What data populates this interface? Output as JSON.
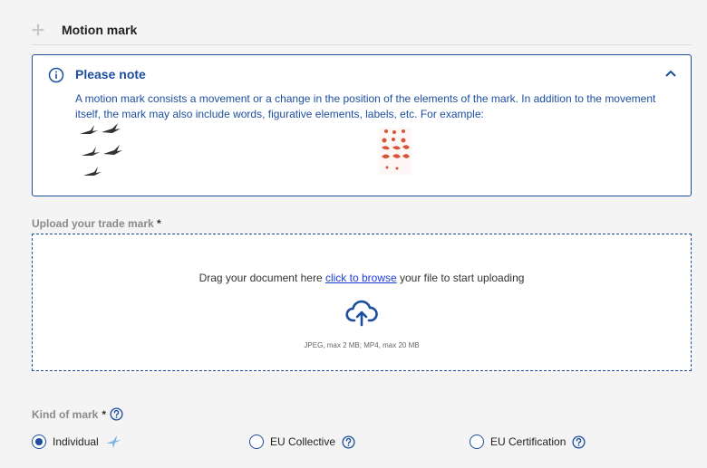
{
  "section": {
    "title": "Motion mark",
    "icon": "motion-arrows-icon"
  },
  "note": {
    "title": "Please note",
    "text": "A motion mark consists a movement or a change in the position of the elements of the mark. In addition to the movement itself, the mark may also include words, figurative elements, labels, etc. For example:",
    "accent_color": "#1d4e9e"
  },
  "upload": {
    "label": "Upload your trade mark",
    "required_marker": "*",
    "drop_prefix": "Drag your document here ",
    "browse_link": "click to browse",
    "drop_suffix": " your file to start uploading",
    "formats": "JPEG, max 2 MB; MP4, max 20 MB"
  },
  "kind": {
    "label": "Kind of mark",
    "required_marker": "*",
    "options": [
      {
        "label": "Individual",
        "selected": true
      },
      {
        "label": "EU Collective",
        "selected": false
      },
      {
        "label": "EU Certification",
        "selected": false
      }
    ]
  }
}
